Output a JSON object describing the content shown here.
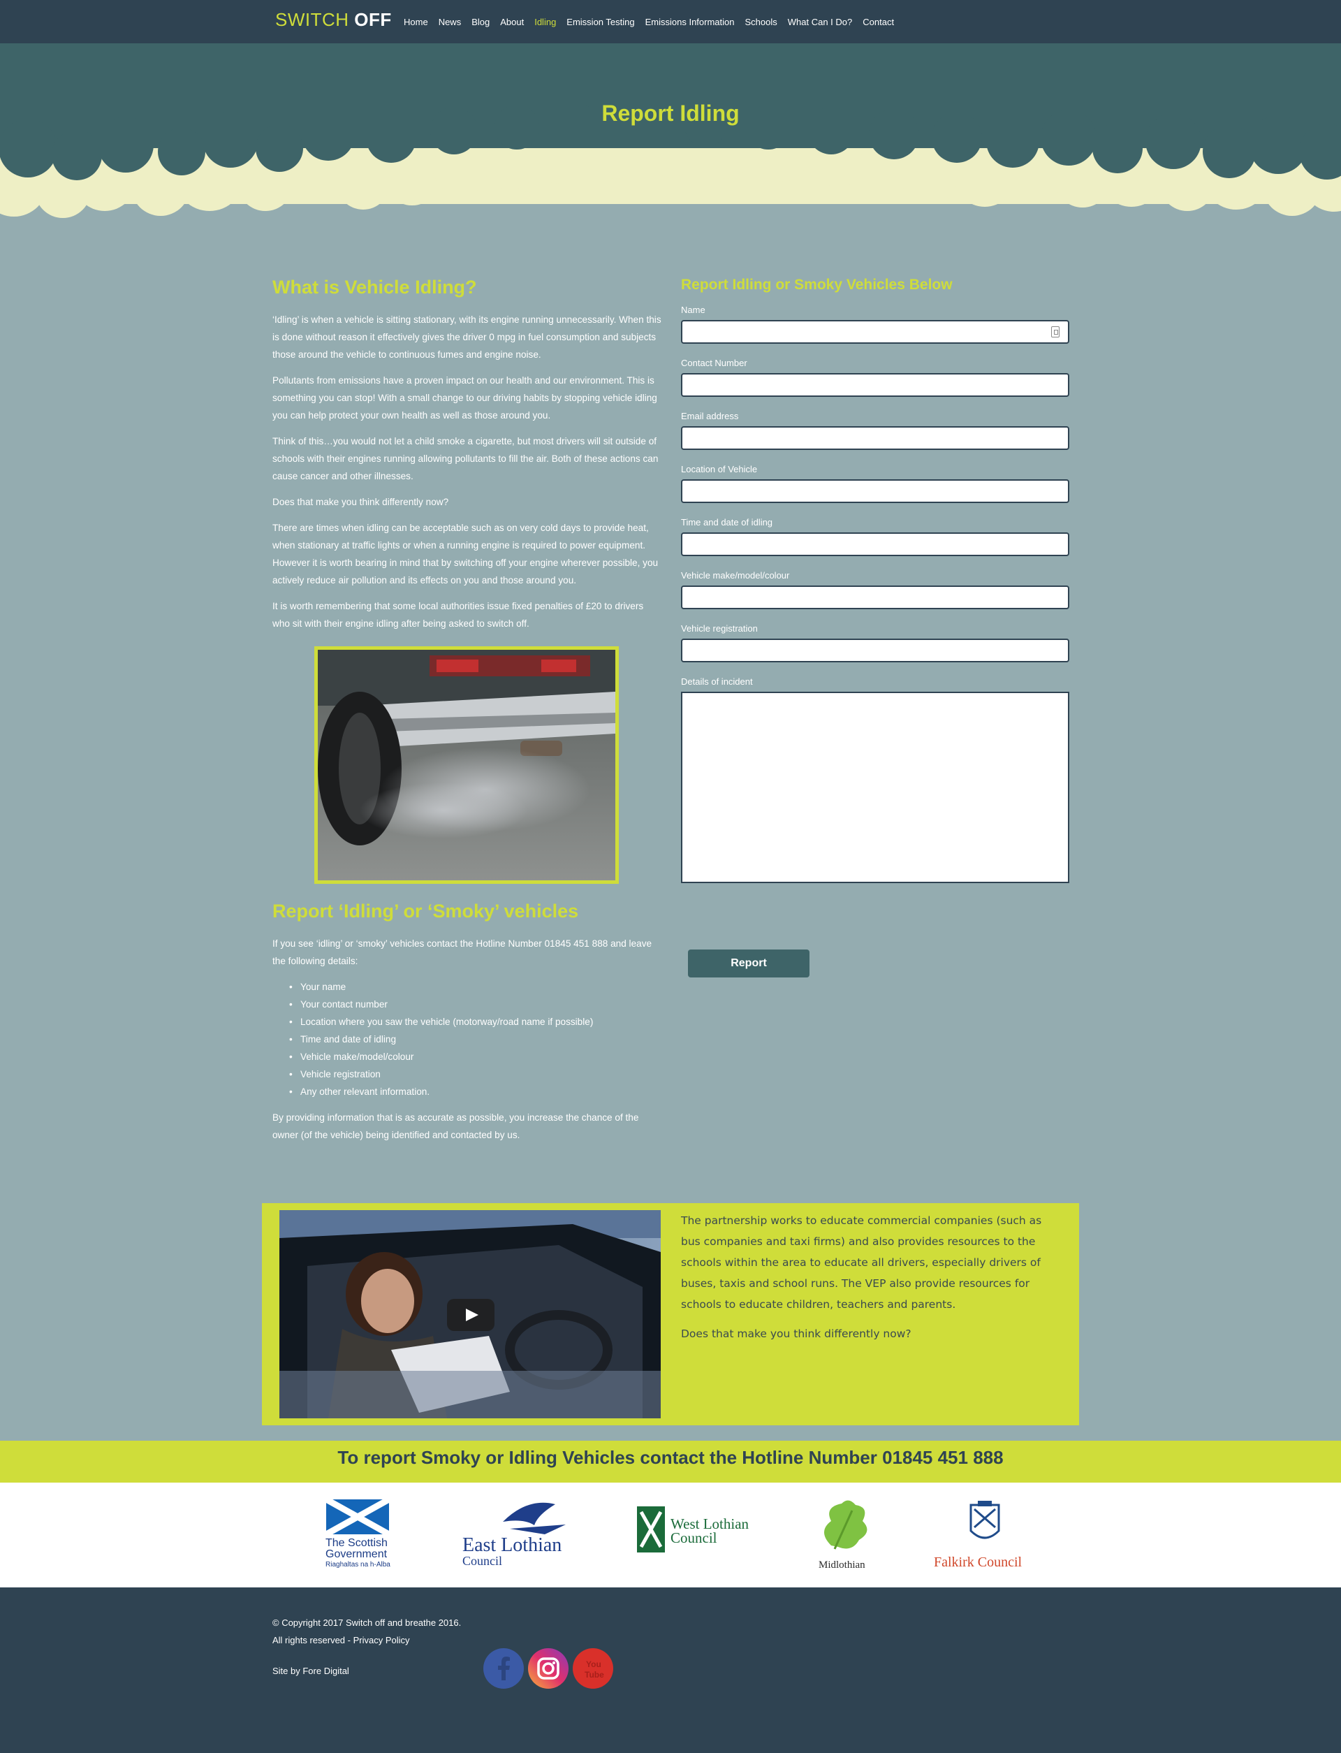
{
  "nav": {
    "logo_part1": "SWITCH",
    "logo_part2": "OFF",
    "items": [
      "Home",
      "News",
      "Blog",
      "About",
      "Idling",
      "Emission Testing",
      "Emissions Information",
      "Schools",
      "What Can I Do?",
      "Contact"
    ],
    "active": "Idling"
  },
  "hero": {
    "title": "Report Idling"
  },
  "left": {
    "heading1": "What is Vehicle Idling?",
    "paragraphs": [
      "‘Idling’ is when a vehicle is sitting stationary, with its engine running unnecessarily. When this is done without reason it effectively gives the driver 0 mpg in fuel consumption and subjects those around the vehicle to continuous fumes and engine noise.",
      "Pollutants from emissions have a proven impact on our health and our environment. This is something you can stop! With a small change to our driving habits by stopping vehicle idling you can help protect your own health as well as those around you.",
      "Think of this…you would not let a child smoke a cigarette, but most drivers will sit outside of schools with their engines running allowing pollutants to fill the air. Both of these actions can cause cancer and other illnesses.",
      "Does that make you think differently now?",
      "There are times when idling can be acceptable such as on very cold days to provide heat, when stationary at traffic lights or when a running engine is required to power equipment. However it is worth bearing in mind that by switching off your engine wherever possible, you actively reduce air pollution and its effects on you and those around you.",
      "It is worth remembering that some local authorities issue fixed penalties of £20 to drivers who sit with their engine idling after being asked to switch off."
    ],
    "heading2": "Report ‘Idling’ or ‘Smoky’ vehicles",
    "report_intro": "If you see ‘idling’ or ‘smoky’ vehicles contact the Hotline Number 01845 451 888 and leave the following details:",
    "details": [
      "Your name",
      "Your contact number",
      "Location where you saw the vehicle (motorway/road name if possible)",
      "Time and date of idling",
      "Vehicle make/model/colour",
      "Vehicle registration",
      "Any other relevant information."
    ],
    "closing": "By providing information that is as accurate as possible, you increase the chance of the owner (of the vehicle) being identified and contacted by us."
  },
  "form": {
    "heading": "Report Idling or Smoky Vehicles Below",
    "fields": {
      "name": "Name",
      "contact": "Contact Number",
      "email": "Email address",
      "location": "Location of Vehicle",
      "time": "Time and date of idling",
      "make": "Vehicle make/model/colour",
      "registration": "Vehicle registration",
      "details": "Details of incident"
    },
    "submit": "Report"
  },
  "panel": {
    "text1": "The partnership works to educate commercial companies (such as bus companies and taxi firms) and also provides resources to the schools within the area to educate all drivers, especially drivers of buses, taxis and school runs. The VEP also provide resources for schools to educate children, teachers and parents.",
    "text2": "Does that make you think differently now?"
  },
  "hotline": "To report Smoky or Idling Vehicles contact the Hotline Number 01845 451 888",
  "partners": {
    "scottish": [
      "The Scottish",
      "Government",
      "Riaghaltas na h-Alba"
    ],
    "east_lothian": [
      "East Lothian",
      "Council"
    ],
    "west_lothian": [
      "West Lothian",
      "Council"
    ],
    "midlothian": "Midlothian",
    "falkirk": "Falkirk Council"
  },
  "footer": {
    "copyright": "© Copyright 2017 Switch off and breathe 2016. All rights reserved - Privacy Policy",
    "site_by": "Site by Fore Digital",
    "youtube_text": [
      "You",
      "Tube"
    ]
  },
  "colors": {
    "accent": "#cfdd3a",
    "dark": "#2f4352",
    "body": "#94acb0",
    "hero": "#3e6468",
    "cloud": "#eeefc5"
  }
}
